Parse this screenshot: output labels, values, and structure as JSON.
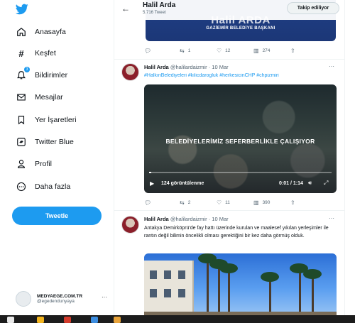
{
  "sidebar": {
    "logo_icon": "twitter-bird-icon",
    "items": [
      {
        "label": "Anasayfa",
        "icon": "home-icon"
      },
      {
        "label": "Keşfet",
        "icon": "hashtag-icon"
      },
      {
        "label": "Bildirimler",
        "icon": "bell-icon",
        "badge": "3"
      },
      {
        "label": "Mesajlar",
        "icon": "mail-icon"
      },
      {
        "label": "Yer İşaretleri",
        "icon": "bookmark-icon"
      },
      {
        "label": "Twitter Blue",
        "icon": "twitter-blue-icon"
      },
      {
        "label": "Profil",
        "icon": "person-icon"
      },
      {
        "label": "Daha fazla",
        "icon": "more-circle-icon"
      }
    ],
    "tweet_button": "Tweetle",
    "account": {
      "name": "MEDYAEGE.COM.TR",
      "handle": "@egedendunyaya",
      "more": "···"
    }
  },
  "header": {
    "back": "←",
    "title": "Halil Arda",
    "subtitle": "5.716 Tweet",
    "follow_label": "Takip ediliyor"
  },
  "card1": {
    "name": "Halil ARDA",
    "subtitle": "GAZİEMİR BELEDİYE BAŞKANI"
  },
  "tweet1_actions": {
    "replies": "",
    "retweets": "1",
    "likes": "12",
    "views": "274"
  },
  "tweet2": {
    "name": "Halil Arda",
    "handle": "@halilardaizmir",
    "date": "· 10 Mar",
    "more": "···",
    "hashtags": "#HalkınBelediyeleri #kilicdarogluk #herkesicinCHP #chpizmiri",
    "video": {
      "caption": "BELEDİYELERİMİZ SEFERBERLİKLE ÇALIŞIYOR",
      "views": "124 görüntülenme",
      "time": "0:01 / 1:14",
      "progress": 0.01
    },
    "actions": {
      "replies": "",
      "retweets": "2",
      "likes": "11",
      "views": "390"
    }
  },
  "tweet3": {
    "name": "Halil Arda",
    "handle": "@halilardaizmir",
    "date": "· 10 Mar",
    "more": "···",
    "text": "Antakya Demirköprü'de fay hattı üzerinde kurulan ve maalesef yıkılan yerleşimler ile rantın değil bilimin öncelikli olması gerektiğini bir kez daha görmüş olduk."
  },
  "colors": {
    "accent": "#1d9bf0",
    "text": "#0f1419",
    "muted": "#536471",
    "taskbar": "#1c1c1c"
  }
}
